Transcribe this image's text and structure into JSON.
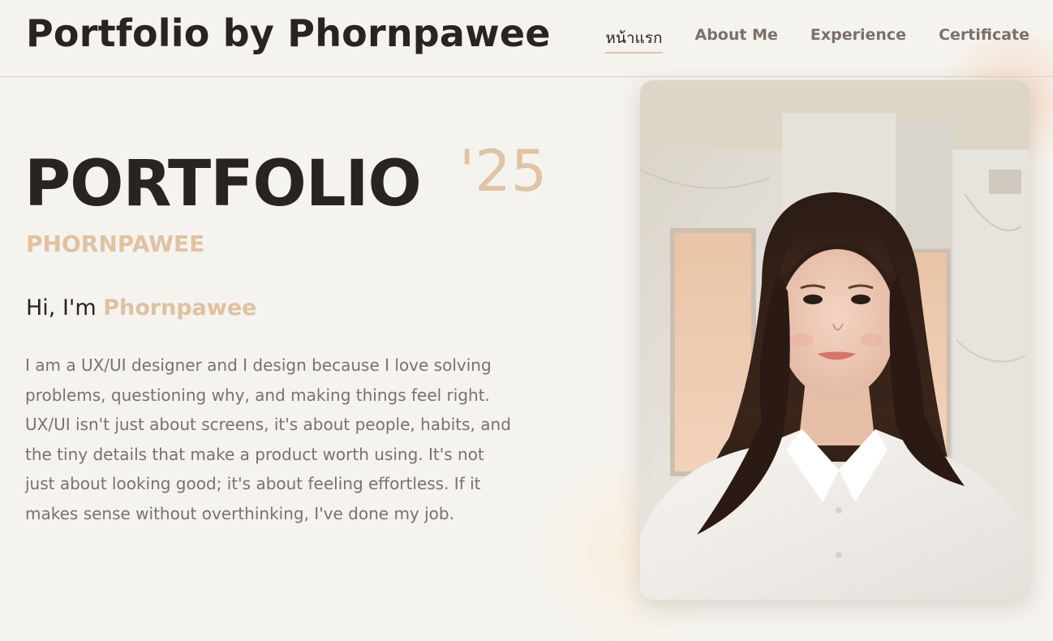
{
  "header": {
    "site_title": "Portfolio by Phornpawee",
    "nav": [
      {
        "label": "หน้าแรก",
        "active": true
      },
      {
        "label": "About Me",
        "active": false
      },
      {
        "label": "Experience",
        "active": false
      },
      {
        "label": "Certificate",
        "active": false
      }
    ]
  },
  "hero": {
    "title": "PORTFOLIO",
    "year": "'25",
    "name_caps": "PHORNPAWEE",
    "greeting_prefix": "Hi, I'm ",
    "greeting_name": "Phornpawee",
    "bio": "I am a UX/UI designer and I design because I love solving problems, questioning why, and making things feel right. UX/UI isn't just about screens, it's about people, habits, and the tiny details that make a product worth using. It's not just about looking good; it's about feeling effortless. If it makes sense without overthinking, I've done my job."
  },
  "photo": {
    "subject": "portrait photo of Phornpawee"
  },
  "colors": {
    "background": "#f5f3ee",
    "text_dark": "#2a2420",
    "text_muted": "#7a726a",
    "accent_beige": "#dfc2a2"
  }
}
